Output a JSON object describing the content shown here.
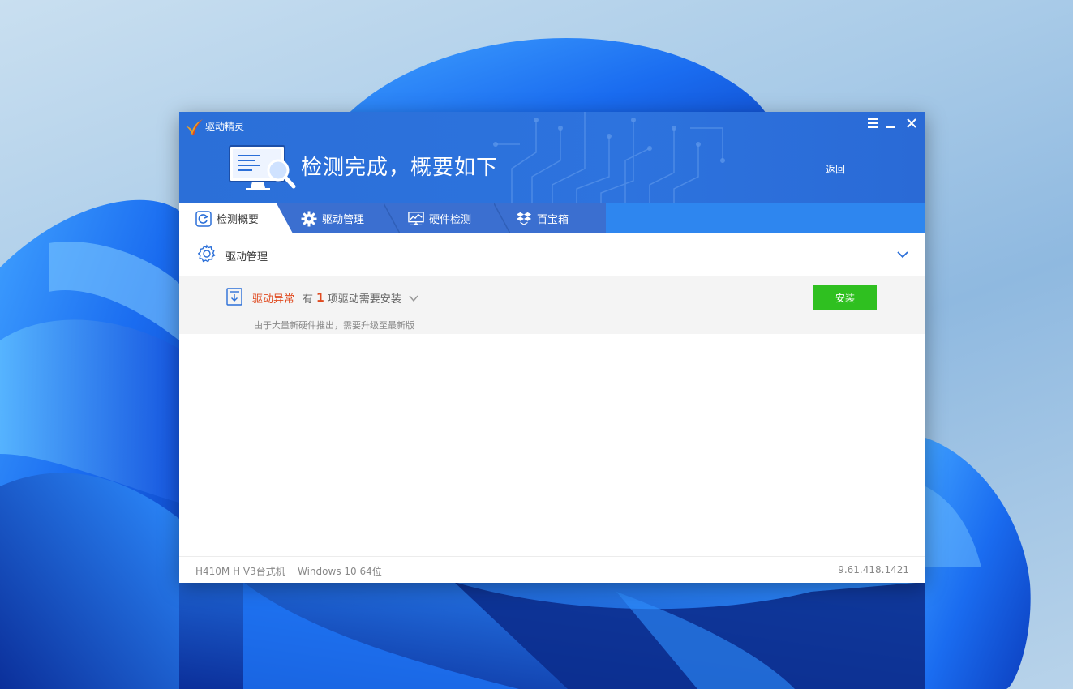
{
  "app": {
    "title": "驱动精灵",
    "headline": "检测完成，概要如下",
    "back_label": "返回"
  },
  "window_controls": {
    "menu_icon": "menu-icon",
    "minimize_icon": "minimize-icon",
    "close_icon": "close-icon"
  },
  "tabs": [
    {
      "label": "检测概要",
      "icon": "refresh-icon",
      "active": true
    },
    {
      "label": "驱动管理",
      "icon": "gear-icon",
      "active": false
    },
    {
      "label": "硬件检测",
      "icon": "monitor-chart-icon",
      "active": false
    },
    {
      "label": "百宝箱",
      "icon": "box-icon",
      "active": false
    }
  ],
  "section": {
    "title": "驱动管理",
    "icon": "gear-icon",
    "collapse_icon": "chevron-down-icon"
  },
  "alert": {
    "status": "驱动异常",
    "prefix": "有",
    "count": "1",
    "suffix": "项驱动需要安装",
    "description": "由于大量新硬件推出，需要升级至最新版",
    "install_label": "安装"
  },
  "statusbar": {
    "machine": "H410M H V3台式机",
    "os": "Windows 10 64位",
    "version": "9.61.418.1421"
  },
  "colors": {
    "header_blue": "#2b6fd8",
    "tab_blue": "#2e86ef",
    "alert_red": "#e04a1f",
    "install_green": "#2fc020"
  }
}
